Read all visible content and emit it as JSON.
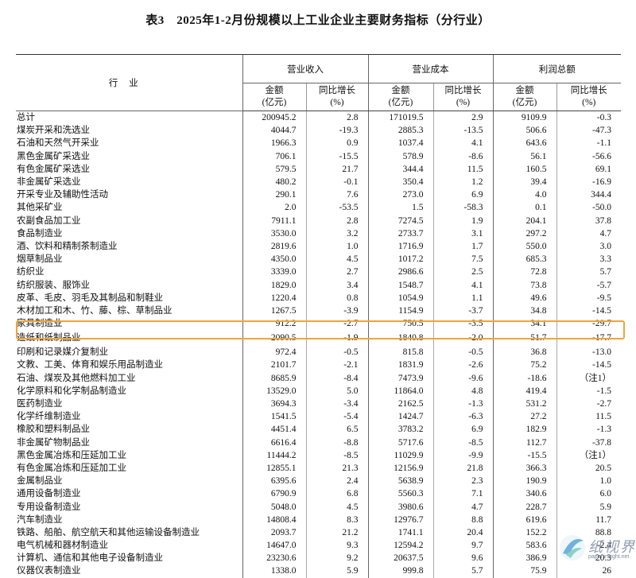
{
  "title": "表3　2025年1-2月份规模以上工业企业主要财务指标（分行业）",
  "header": {
    "industry": "行业",
    "groups": [
      "营业收入",
      "营业成本",
      "利润总额"
    ],
    "amount": "金额",
    "amount_unit": "(亿元)",
    "growth": "同比增长",
    "growth_unit": "(%)"
  },
  "rows": [
    [
      "总计",
      "200945.2",
      "2.8",
      "171019.5",
      "2.9",
      "9109.9",
      "-0.3"
    ],
    [
      "煤炭开采和洗选业",
      "4044.7",
      "-19.3",
      "2885.3",
      "-13.5",
      "506.6",
      "-47.3"
    ],
    [
      "石油和天然气开采业",
      "1966.3",
      "0.9",
      "1037.4",
      "4.1",
      "643.6",
      "-1.1"
    ],
    [
      "黑色金属矿采选业",
      "706.1",
      "-15.5",
      "578.9",
      "-8.6",
      "56.1",
      "-56.6"
    ],
    [
      "有色金属矿采选业",
      "579.5",
      "21.7",
      "344.4",
      "11.5",
      "160.5",
      "69.1"
    ],
    [
      "非金属矿采选业",
      "480.2",
      "-0.1",
      "350.4",
      "1.2",
      "39.4",
      "-16.9"
    ],
    [
      "开采专业及辅助性活动",
      "290.1",
      "7.6",
      "273.0",
      "6.9",
      "4.0",
      "344.4"
    ],
    [
      "其他采矿业",
      "2.0",
      "-53.5",
      "1.5",
      "-58.3",
      "0.1",
      "-50.0"
    ],
    [
      "农副食品加工业",
      "7911.1",
      "2.8",
      "7274.5",
      "1.9",
      "204.1",
      "37.8"
    ],
    [
      "食品制造业",
      "3530.0",
      "3.2",
      "2733.7",
      "3.1",
      "297.2",
      "4.7"
    ],
    [
      "酒、饮料和精制茶制造业",
      "2819.6",
      "1.0",
      "1716.9",
      "1.7",
      "550.0",
      "3.0"
    ],
    [
      "烟草制品业",
      "4350.0",
      "4.5",
      "1017.2",
      "7.5",
      "685.3",
      "3.3"
    ],
    [
      "纺织业",
      "3339.0",
      "2.7",
      "2986.6",
      "2.5",
      "72.8",
      "5.7"
    ],
    [
      "纺织服装、服饰业",
      "1829.0",
      "3.4",
      "1548.7",
      "4.1",
      "73.8",
      "-5.7"
    ],
    [
      "皮革、毛皮、羽毛及其制品和制鞋业",
      "1220.4",
      "0.8",
      "1054.9",
      "1.1",
      "49.6",
      "-9.5"
    ],
    [
      "木材加工和木、竹、藤、棕、草制品业",
      "1267.5",
      "-3.9",
      "1154.9",
      "-3.7",
      "34.8",
      "-14.5"
    ],
    [
      "家具制造业",
      "912.2",
      "-2.7",
      "750.5",
      "-3.5",
      "34.1",
      "-29.7"
    ],
    [
      "造纸和纸制品业",
      "2090.5",
      "-1.9",
      "1840.8",
      "-2.0",
      "51.7",
      "-17.7"
    ],
    [
      "印刷和记录媒介复制业",
      "972.4",
      "-0.5",
      "815.8",
      "-0.5",
      "36.8",
      "-13.0"
    ],
    [
      "文教、工美、体育和娱乐用品制造业",
      "2101.7",
      "-2.1",
      "1831.9",
      "-2.6",
      "75.2",
      "-14.5"
    ],
    [
      "石油、煤炭及其他燃料加工业",
      "8685.9",
      "-8.4",
      "7473.9",
      "-9.6",
      "-18.6",
      "（注1）"
    ],
    [
      "化学原料和化学制品制造业",
      "13529.0",
      "5.0",
      "11864.0",
      "4.8",
      "419.4",
      "-1.5"
    ],
    [
      "医药制造业",
      "3694.3",
      "-3.4",
      "2162.5",
      "-1.3",
      "531.2",
      "-2.7"
    ],
    [
      "化学纤维制造业",
      "1541.5",
      "-5.4",
      "1424.7",
      "-6.3",
      "27.2",
      "11.5"
    ],
    [
      "橡胶和塑料制品业",
      "4451.4",
      "6.5",
      "3783.2",
      "6.9",
      "182.9",
      "-1.3"
    ],
    [
      "非金属矿物制品业",
      "6616.4",
      "-8.8",
      "5717.6",
      "-8.5",
      "112.7",
      "-37.8"
    ],
    [
      "黑色金属冶炼和压延加工业",
      "11444.2",
      "-8.5",
      "11029.9",
      "-9.9",
      "-15.5",
      "（注1）"
    ],
    [
      "有色金属冶炼和压延加工业",
      "12855.1",
      "21.3",
      "12156.9",
      "21.8",
      "366.3",
      "20.5"
    ],
    [
      "金属制品业",
      "6395.6",
      "2.4",
      "5638.9",
      "2.3",
      "190.9",
      "1.0"
    ],
    [
      "通用设备制造业",
      "6790.9",
      "6.8",
      "5560.3",
      "7.1",
      "340.6",
      "6.0"
    ],
    [
      "专用设备制造业",
      "5048.0",
      "4.5",
      "3980.6",
      "4.7",
      "228.7",
      "5.9"
    ],
    [
      "汽车制造业",
      "14808.4",
      "8.3",
      "12976.7",
      "8.8",
      "619.6",
      "11.7"
    ],
    [
      "铁路、船舶、航空航天和其他运输设备制造业",
      "2093.7",
      "21.2",
      "1741.1",
      "20.4",
      "152.2",
      "88.8"
    ],
    [
      "电气机械和器材制造业",
      "14647.0",
      "9.3",
      "12594.2",
      "9.7",
      "583.6",
      "-2.4"
    ],
    [
      "计算机、通信和其他电子设备制造业",
      "23230.6",
      "9.2",
      "20637.5",
      "9.6",
      "386.9",
      "20.3"
    ],
    [
      "仪器仪表制造业",
      "1338.0",
      "5.9",
      "999.8",
      "5.7",
      "75.9",
      "26"
    ]
  ],
  "highlight_row_index": 17,
  "watermark": {
    "text": "纸视界",
    "url": "paper.insight.net"
  },
  "colors": {
    "highlight": "#f0a43a",
    "watermark": "#7c8ba4"
  }
}
